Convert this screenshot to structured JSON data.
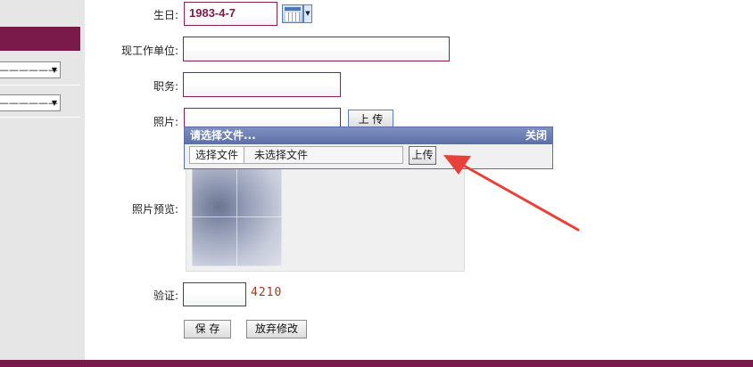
{
  "sidebar": {
    "select1": {
      "value": "——————"
    },
    "select2": {
      "value": "——————"
    }
  },
  "form": {
    "birthday": {
      "label": "生日:",
      "value": "1983-4-7",
      "calendar_icon": "calendar-icon"
    },
    "employer": {
      "label": "现工作单位:",
      "value": ""
    },
    "position": {
      "label": "职务:",
      "value": ""
    },
    "photo": {
      "label": "照片:",
      "value": "",
      "upload_label": "上 传"
    },
    "preview": {
      "label": "照片预览:"
    },
    "captcha": {
      "label": "验证:",
      "value": "",
      "code": "4210"
    },
    "save_label": "保 存",
    "discard_label": "放弃修改"
  },
  "upload_popup": {
    "title": "请选择文件...",
    "close_label": "关闭",
    "choose_file_label": "选择文件",
    "no_file_text": "未选择文件",
    "upload_label": "上传"
  },
  "colors": {
    "accent": "#7a1a4a",
    "popup_title": "#5c6ea6",
    "arrow": "#e8413a"
  }
}
